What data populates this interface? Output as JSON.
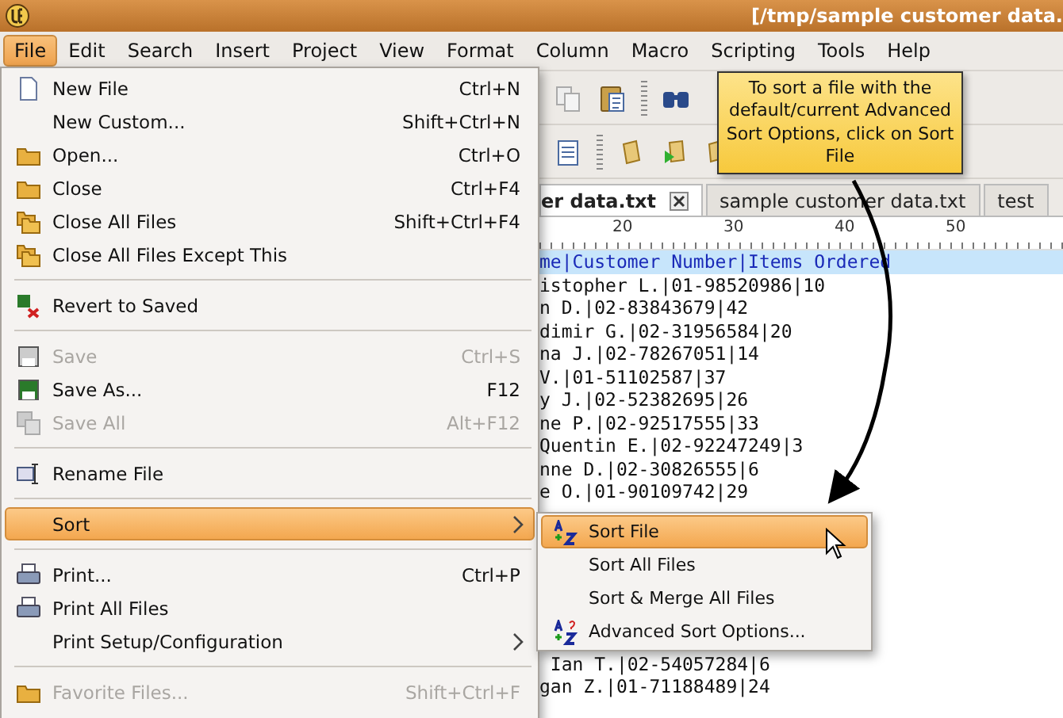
{
  "window": {
    "title": "[/tmp/sample customer data."
  },
  "menubar": [
    {
      "label": "File",
      "selected": true
    },
    {
      "label": "Edit",
      "selected": false
    },
    {
      "label": "Search",
      "selected": false
    },
    {
      "label": "Insert",
      "selected": false
    },
    {
      "label": "Project",
      "selected": false
    },
    {
      "label": "View",
      "selected": false
    },
    {
      "label": "Format",
      "selected": false
    },
    {
      "label": "Column",
      "selected": false
    },
    {
      "label": "Macro",
      "selected": false
    },
    {
      "label": "Scripting",
      "selected": false
    },
    {
      "label": "Tools",
      "selected": false
    },
    {
      "label": "Help",
      "selected": false
    }
  ],
  "file_menu": [
    {
      "kind": "item",
      "label": "New File",
      "shortcut": "Ctrl+N",
      "disabled": false,
      "selected": false,
      "submenu": false
    },
    {
      "kind": "item",
      "label": "New Custom...",
      "shortcut": "Shift+Ctrl+N",
      "disabled": false,
      "selected": false,
      "submenu": false
    },
    {
      "kind": "item",
      "label": "Open...",
      "shortcut": "Ctrl+O",
      "disabled": false,
      "selected": false,
      "submenu": false
    },
    {
      "kind": "item",
      "label": "Close",
      "shortcut": "Ctrl+F4",
      "disabled": false,
      "selected": false,
      "submenu": false
    },
    {
      "kind": "item",
      "label": "Close All Files",
      "shortcut": "Shift+Ctrl+F4",
      "disabled": false,
      "selected": false,
      "submenu": false
    },
    {
      "kind": "item",
      "label": "Close All Files Except This",
      "disabled": false,
      "selected": false,
      "submenu": false
    },
    {
      "kind": "separator"
    },
    {
      "kind": "item",
      "label": "Revert to Saved",
      "disabled": false,
      "selected": false,
      "submenu": false
    },
    {
      "kind": "separator"
    },
    {
      "kind": "item",
      "label": "Save",
      "shortcut": "Ctrl+S",
      "disabled": true,
      "selected": false,
      "submenu": false
    },
    {
      "kind": "item",
      "label": "Save As...",
      "shortcut": "F12",
      "disabled": false,
      "selected": false,
      "submenu": false
    },
    {
      "kind": "item",
      "label": "Save All",
      "shortcut": "Alt+F12",
      "disabled": true,
      "selected": false,
      "submenu": false
    },
    {
      "kind": "separator"
    },
    {
      "kind": "item",
      "label": "Rename File",
      "disabled": false,
      "selected": false,
      "submenu": false
    },
    {
      "kind": "separator"
    },
    {
      "kind": "item",
      "label": "Sort",
      "disabled": false,
      "selected": true,
      "submenu": true
    },
    {
      "kind": "separator"
    },
    {
      "kind": "item",
      "label": "Print...",
      "shortcut": "Ctrl+P",
      "disabled": false,
      "selected": false,
      "submenu": false
    },
    {
      "kind": "item",
      "label": "Print All Files",
      "disabled": false,
      "selected": false,
      "submenu": false
    },
    {
      "kind": "item",
      "label": "Print Setup/Configuration",
      "disabled": false,
      "selected": false,
      "submenu": true
    },
    {
      "kind": "separator"
    },
    {
      "kind": "item",
      "label": "Favorite Files...",
      "shortcut": "Shift+Ctrl+F",
      "disabled": true,
      "selected": false,
      "submenu": false
    }
  ],
  "sort_submenu": [
    {
      "label": "Sort File",
      "selected": true
    },
    {
      "label": "Sort All Files",
      "selected": false
    },
    {
      "label": "Sort & Merge All Files",
      "selected": false
    },
    {
      "label": "Advanced Sort Options...",
      "selected": false
    }
  ],
  "tooltip": {
    "text": "To sort a file with the default/current Advanced Sort Options, click on Sort File"
  },
  "tabs": [
    {
      "label": "er data.txt",
      "selected": true
    },
    {
      "label": "sample customer data.txt",
      "selected": false
    },
    {
      "label": "test",
      "selected": false
    }
  ],
  "ruler": {
    "labels": [
      "20",
      "30",
      "40",
      "50"
    ]
  },
  "editor": {
    "lines_above": [
      {
        "text": "me|Customer Number|Items Ordered",
        "current": true
      },
      {
        "text": "istopher L.|01-98520986|10",
        "current": false
      },
      {
        "text": "n D.|02-83843679|42",
        "current": false
      },
      {
        "text": "dimir G.|02-31956584|20",
        "current": false
      },
      {
        "text": "na J.|02-78267051|14",
        "current": false
      },
      {
        "text": "V.|01-51102587|37",
        "current": false
      },
      {
        "text": "y J.|02-52382695|26",
        "current": false
      },
      {
        "text": "ne P.|02-92517555|33",
        "current": false
      },
      {
        "text": "Quentin E.|02-92247249|3",
        "current": false
      },
      {
        "text": "nne D.|02-30826555|6",
        "current": false
      },
      {
        "text": "e O.|01-90109742|29",
        "current": false
      }
    ],
    "lines_below": [
      {
        "text": " Ian T.|02-54057284|6",
        "current": false
      },
      {
        "text": "gan Z.|01-71188489|24",
        "current": false
      }
    ]
  }
}
